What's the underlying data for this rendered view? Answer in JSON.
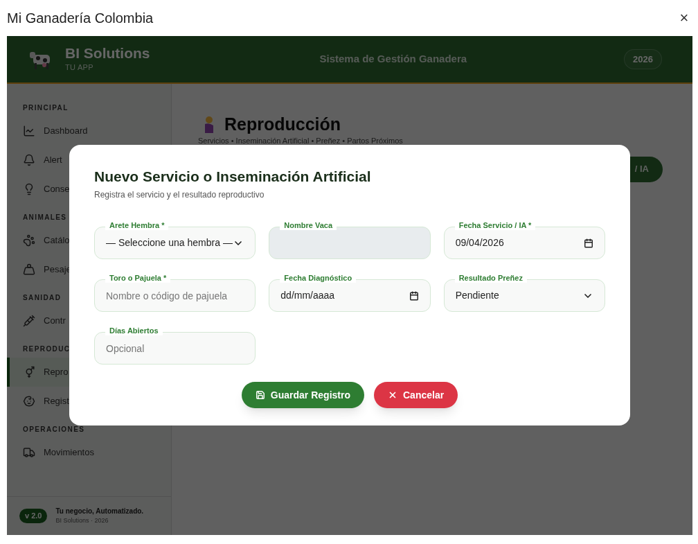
{
  "window": {
    "title": "Mi Ganadería Colombia",
    "close": "×"
  },
  "header": {
    "brand": "BI Solutions",
    "tagline": "TU APP",
    "title": "Sistema de Gestión Ganadera",
    "year": "2026"
  },
  "sidebar": {
    "sections": [
      {
        "title": "PRINCIPAL",
        "items": [
          {
            "label": "Dashboard",
            "selected": false
          },
          {
            "label": "Alert",
            "selected": false
          },
          {
            "label": "Conse",
            "selected": false
          }
        ]
      },
      {
        "title": "ANIMALES",
        "items": [
          {
            "label": "Catálo",
            "selected": false
          },
          {
            "label": "Pesaje",
            "selected": false
          }
        ]
      },
      {
        "title": "SANIDAD",
        "items": [
          {
            "label": "Contr",
            "selected": false
          }
        ]
      },
      {
        "title": "REPRODUC",
        "items": [
          {
            "label": "Repro",
            "selected": true
          },
          {
            "label": "Regist",
            "selected": false
          }
        ]
      },
      {
        "title": "OPERACIONES",
        "items": [
          {
            "label": "Movimientos",
            "selected": false
          }
        ]
      }
    ],
    "footer": {
      "version": "v 2.0",
      "slogan": "Tu negocio, Automatizado.",
      "credit": "BI Solutions · 2026"
    }
  },
  "page": {
    "title": "Reproducción",
    "subtitle": "Servicios • Inseminación Artificial • Preñez • Partos Próximos",
    "action": "/ IA"
  },
  "modal": {
    "title": "Nuevo Servicio o Inseminación Artificial",
    "subtitle": "Registra el servicio y el resultado reproductivo",
    "fields": [
      {
        "kind": "select",
        "label": "Arete Hembra *",
        "value": "— Seleccione una hembra —"
      },
      {
        "kind": "readonly",
        "label": "Nombre Vaca"
      },
      {
        "kind": "date",
        "label": "Fecha Servicio / IA *",
        "value": "09/04/2026"
      },
      {
        "kind": "text",
        "label": "Toro o Pajuela *",
        "placeholder": "Nombre o código de pajuela"
      },
      {
        "kind": "date",
        "label": "Fecha Diagnóstico",
        "placeholder": "dd/mm/aaaa"
      },
      {
        "kind": "select",
        "label": "Resultado Preñez",
        "value": "Pendiente"
      },
      {
        "kind": "text",
        "label": "Días Abiertos",
        "placeholder": "Opcional"
      }
    ],
    "buttons": [
      {
        "kind": "save",
        "label": "Guardar Registro"
      },
      {
        "kind": "cancel",
        "label": "Cancelar"
      }
    ]
  }
}
